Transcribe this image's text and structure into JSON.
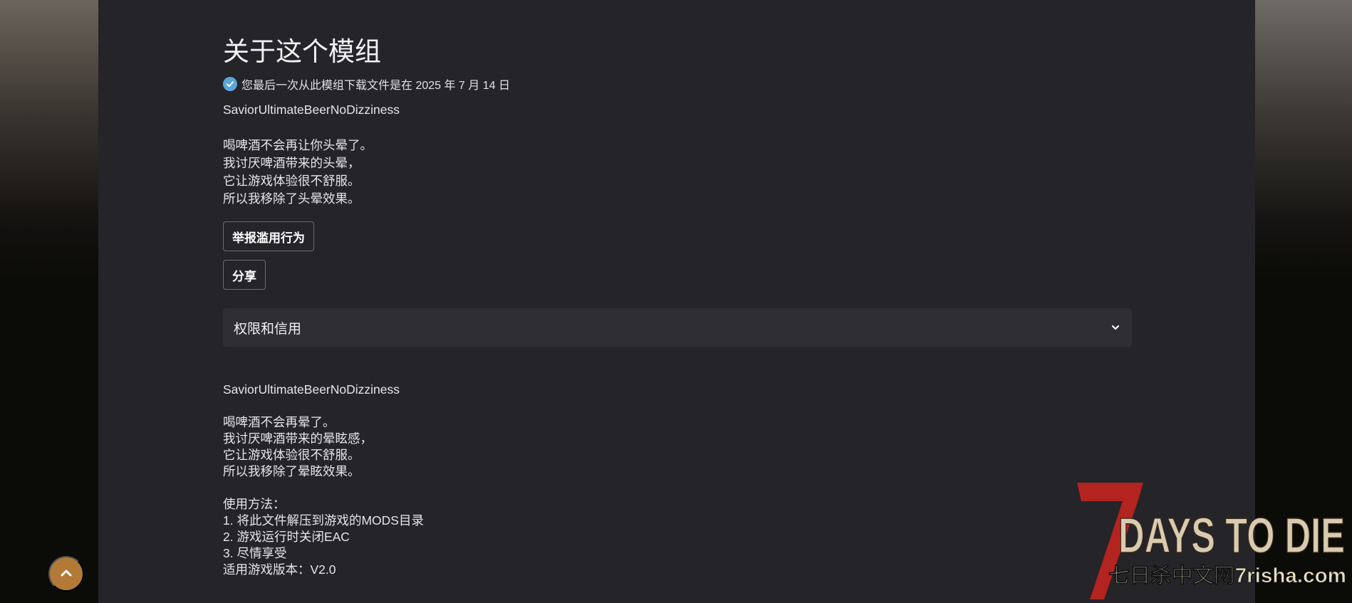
{
  "page": {
    "title": "关于这个模组",
    "download_note": "您最后一次从此模组下载文件是在 2025 年 7 月 14 日"
  },
  "description_original": {
    "mod_name": "SaviorUltimateBeerNoDizziness",
    "lines": [
      "喝啤酒不会再让你头晕了。",
      "我讨厌啤酒带来的头晕，",
      "它让游戏体验很不舒服。",
      "所以我移除了头晕效果。"
    ]
  },
  "buttons": {
    "report": "举报滥用行为",
    "share": "分享"
  },
  "accordion": {
    "label": "权限和信用"
  },
  "description_translated": {
    "mod_name": "SaviorUltimateBeerNoDizziness",
    "lines": [
      "喝啤酒不会再晕了。",
      "我讨厌啤酒带来的晕眩感，",
      "它让游戏体验很不舒服。",
      "所以我移除了晕眩效果。"
    ],
    "usage_title": "使用方法：",
    "usage_steps": [
      "1. 将此文件解压到游戏的MODS目录",
      "2. 游戏运行时关闭EAC",
      "3. 尽情享受"
    ],
    "version": "适用游戏版本：V2.0"
  },
  "watermark": {
    "logo_text": "7DAYS TO DIE",
    "site_text": "七日杀中文网7risha.com"
  },
  "colors": {
    "panel_bg": "#252429",
    "accordion_bg": "#2f2e34",
    "check_icon": "#5aa6d8",
    "back_to_top": "#b27a36",
    "logo_red": "#b3231f",
    "logo_text": "#d9cbb0"
  },
  "icons": {
    "check": "check-circle-icon",
    "chevron": "chevron-down-icon",
    "back_to_top": "chevron-up-icon"
  }
}
